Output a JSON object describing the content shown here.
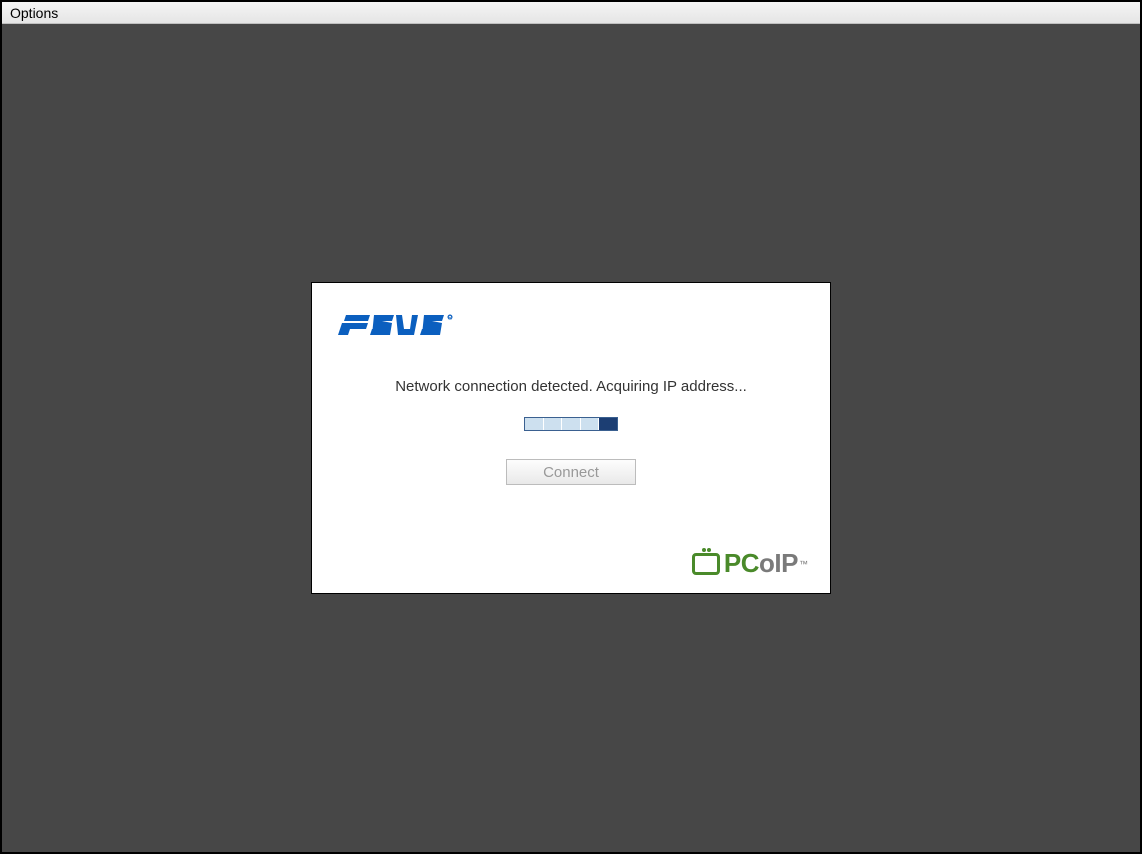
{
  "menubar": {
    "options_label": "Options"
  },
  "panel": {
    "brand_logo_alt": "ASUS",
    "status_message": "Network connection detected. Acquiring IP address...",
    "connect_label": "Connect",
    "progress_segments": 5,
    "progress_active_index": 4
  },
  "footer": {
    "protocol_logo_alt": "PCoIP",
    "protocol_text_pc": "PC",
    "protocol_text_oip": "oIP",
    "trademark": "™"
  }
}
